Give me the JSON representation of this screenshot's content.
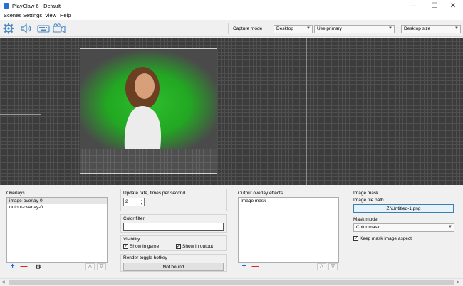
{
  "window": {
    "title": "PlayClaw 6 - Default",
    "minimize": "—",
    "maximize": "☐",
    "close": "✕"
  },
  "menu": {
    "items": [
      {
        "label": "Scenes"
      },
      {
        "label": "Settings"
      },
      {
        "label": "View"
      },
      {
        "label": "Help"
      }
    ]
  },
  "toolbar": {
    "icons": [
      "gear-icon",
      "speaker-icon",
      "keyboard-icon",
      "video-camera-icon"
    ],
    "capture_mode_label": "Capture mode",
    "capture_mode_value": "Desktop",
    "monitor_value": "Use primary",
    "size_value": "Desktop size"
  },
  "overlays": {
    "title": "Overlays",
    "items": [
      {
        "label": "image-overlay-0"
      },
      {
        "label": "output-overlay-0"
      }
    ],
    "add": "+",
    "remove": "—",
    "settings": "⚙",
    "up": "△",
    "down": "▽"
  },
  "update_rate": {
    "label": "Update rate, times per second",
    "value": "2"
  },
  "color_filter": {
    "label": "Color filter",
    "value": ""
  },
  "visibility": {
    "label": "Visibility",
    "show_in_game": "Show in game",
    "show_in_output": "Show in output",
    "show_in_game_checked": true,
    "show_in_output_checked": true
  },
  "render_toggle": {
    "label": "Render toggle hotkey",
    "value": "Not bound"
  },
  "effects": {
    "title": "Output overlay effects",
    "items": [
      {
        "label": "Image mask"
      }
    ],
    "add": "+",
    "remove": "—",
    "up": "△",
    "down": "▽"
  },
  "image_mask": {
    "title": "Image mask",
    "file_label": "Image file path",
    "file_value": "Z:\\Untitled-1.png",
    "mode_label": "Mask mode",
    "mode_value": "Color mask",
    "keep_aspect": "Keep mask image aspect",
    "keep_aspect_checked": true
  },
  "scrollbar": {
    "left": "◀",
    "right": "▶"
  }
}
